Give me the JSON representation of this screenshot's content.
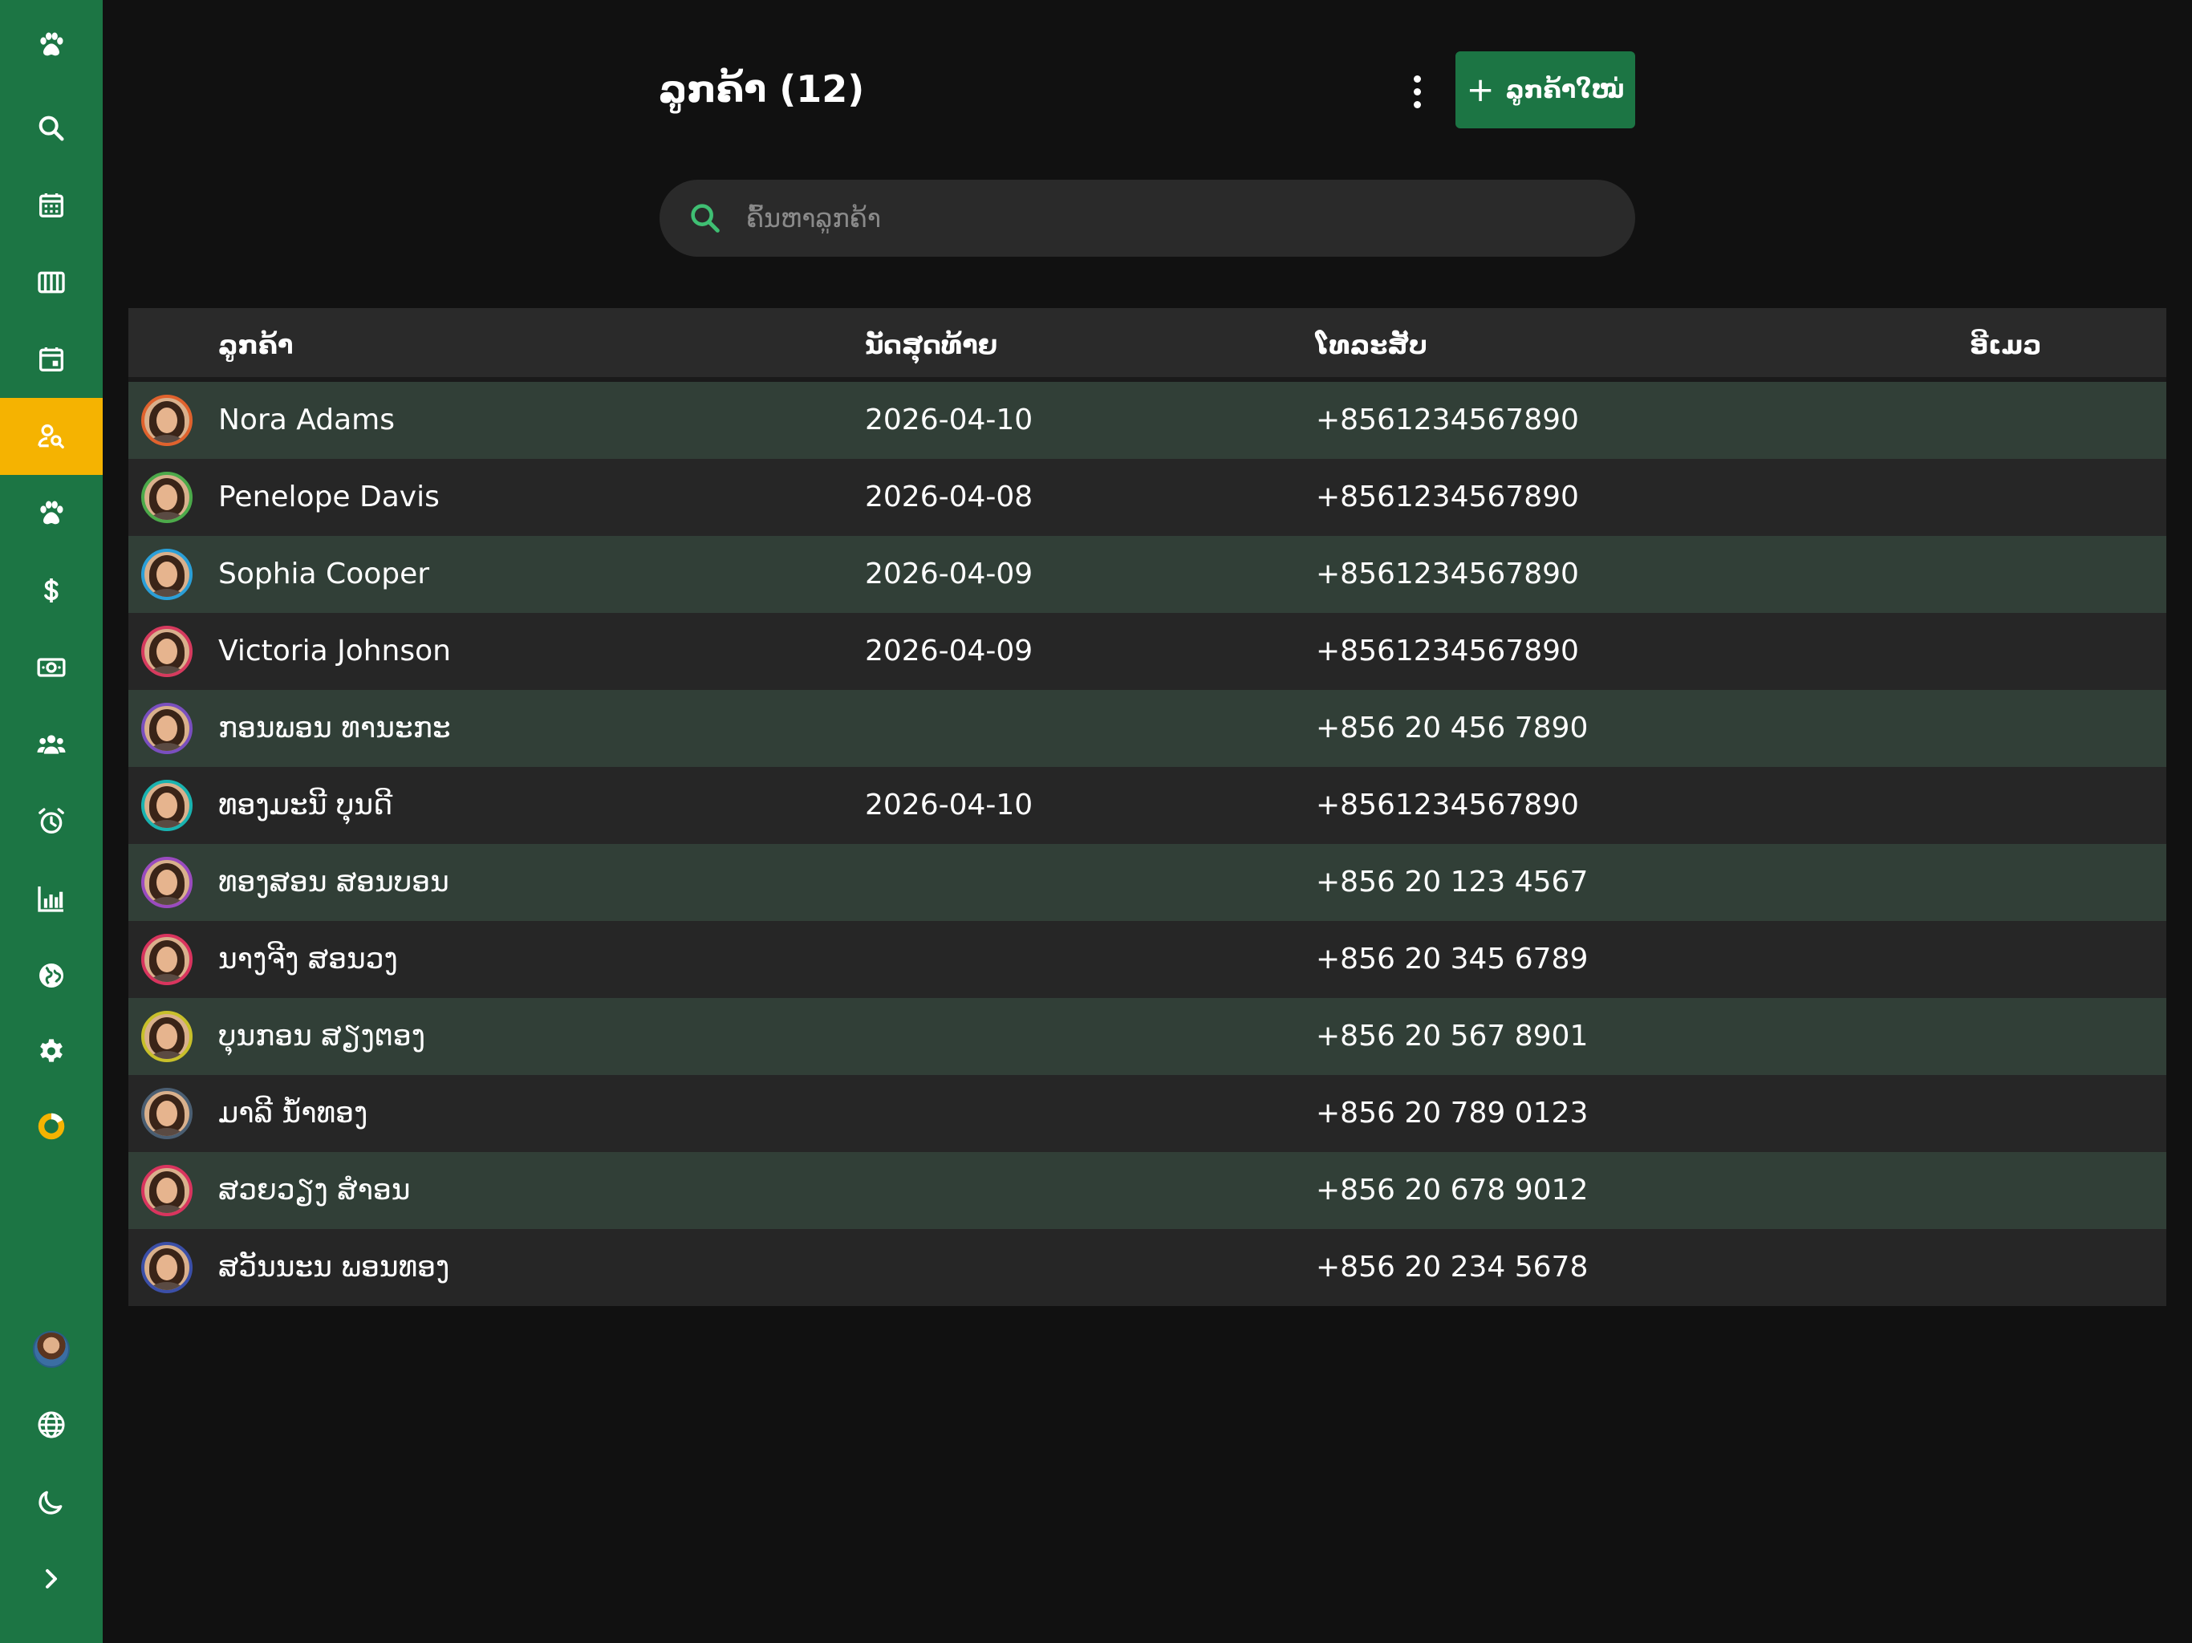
{
  "sidebar": {
    "items": [
      {
        "id": "logo",
        "icon": "paw-icon",
        "active": false
      },
      {
        "id": "search",
        "icon": "search-icon",
        "active": false
      },
      {
        "id": "calendar",
        "icon": "calendar-grid-icon",
        "active": false
      },
      {
        "id": "boarding",
        "icon": "kennel-icon",
        "active": false
      },
      {
        "id": "appointments",
        "icon": "calendar-event-icon",
        "active": false
      },
      {
        "id": "customers",
        "icon": "user-search-icon",
        "active": true
      },
      {
        "id": "pets",
        "icon": "paw-icon",
        "active": false
      },
      {
        "id": "pricing",
        "icon": "dollar-icon",
        "active": false
      },
      {
        "id": "payments",
        "icon": "cash-icon",
        "active": false
      },
      {
        "id": "staff",
        "icon": "users-icon",
        "active": false
      },
      {
        "id": "reminders",
        "icon": "alarm-icon",
        "active": false
      },
      {
        "id": "reports",
        "icon": "bar-chart-icon",
        "active": false
      },
      {
        "id": "web",
        "icon": "globe-filled-icon",
        "active": false
      },
      {
        "id": "settings",
        "icon": "gear-icon",
        "active": false
      },
      {
        "id": "status",
        "icon": "ring-icon",
        "active": false
      }
    ],
    "bottom": [
      {
        "id": "profile",
        "icon": "avatar"
      },
      {
        "id": "language",
        "icon": "globe-icon"
      },
      {
        "id": "theme",
        "icon": "moon-icon"
      },
      {
        "id": "expand",
        "icon": "chevron-right-icon"
      }
    ],
    "accent": "#1c7544",
    "active_color": "#f5b301"
  },
  "header": {
    "title": "ລູກຄ້າ (12)",
    "new_button_label": "ລູກຄ້າໃໝ່",
    "new_button_icon": "+"
  },
  "search": {
    "placeholder": "ຄົ້ນຫາລູກຄ້າ",
    "value": ""
  },
  "table": {
    "columns": {
      "customer": "ລູກຄ້າ",
      "last_appointment": "ນັດສຸດທ້າຍ",
      "phone": "ໂທລະສັບ",
      "email": "ອີເມວ"
    },
    "rows": [
      {
        "name": "Nora Adams",
        "last": "2026-04-10",
        "phone": "+8561234567890",
        "email": "",
        "ring": "#e0622d"
      },
      {
        "name": "Penelope Davis",
        "last": "2026-04-08",
        "phone": "+8561234567890",
        "email": "",
        "ring": "#4caa4a"
      },
      {
        "name": "Sophia Cooper",
        "last": "2026-04-09",
        "phone": "+8561234567890",
        "email": "",
        "ring": "#2a9fd8"
      },
      {
        "name": "Victoria Johnson",
        "last": "2026-04-09",
        "phone": "+8561234567890",
        "email": "",
        "ring": "#d63a5e"
      },
      {
        "name": "ກອນພອນ ທານະກະ",
        "last": "",
        "phone": "+856 20 456 7890",
        "email": "",
        "ring": "#7a4fbf"
      },
      {
        "name": "ທອງມະນີ ບຸນດີ",
        "last": "2026-04-10",
        "phone": "+8561234567890",
        "email": "",
        "ring": "#19b3b0"
      },
      {
        "name": "ທອງສອນ ສອນບອນ",
        "last": "",
        "phone": "+856 20 123 4567",
        "email": "",
        "ring": "#9a4bbf"
      },
      {
        "name": "ນາງຈີງ ສອນວງ",
        "last": "",
        "phone": "+856 20 345 6789",
        "email": "",
        "ring": "#d9345e"
      },
      {
        "name": "ບຸນກອນ ສຽງຕອງ",
        "last": "",
        "phone": "+856 20 567 8901",
        "email": "",
        "ring": "#c8c02a"
      },
      {
        "name": "ມາລີ ນ້ຳທອງ",
        "last": "",
        "phone": "+856 20 789 0123",
        "email": "",
        "ring": "#4a5e72"
      },
      {
        "name": "ສວຍວຽງ ສຳອນ",
        "last": "",
        "phone": "+856 20 678 9012",
        "email": "",
        "ring": "#d9345e"
      },
      {
        "name": "ສວັນນະນ ພອນທອງ",
        "last": "",
        "phone": "+856 20 234 5678",
        "email": "",
        "ring": "#3b4fa8"
      }
    ]
  }
}
